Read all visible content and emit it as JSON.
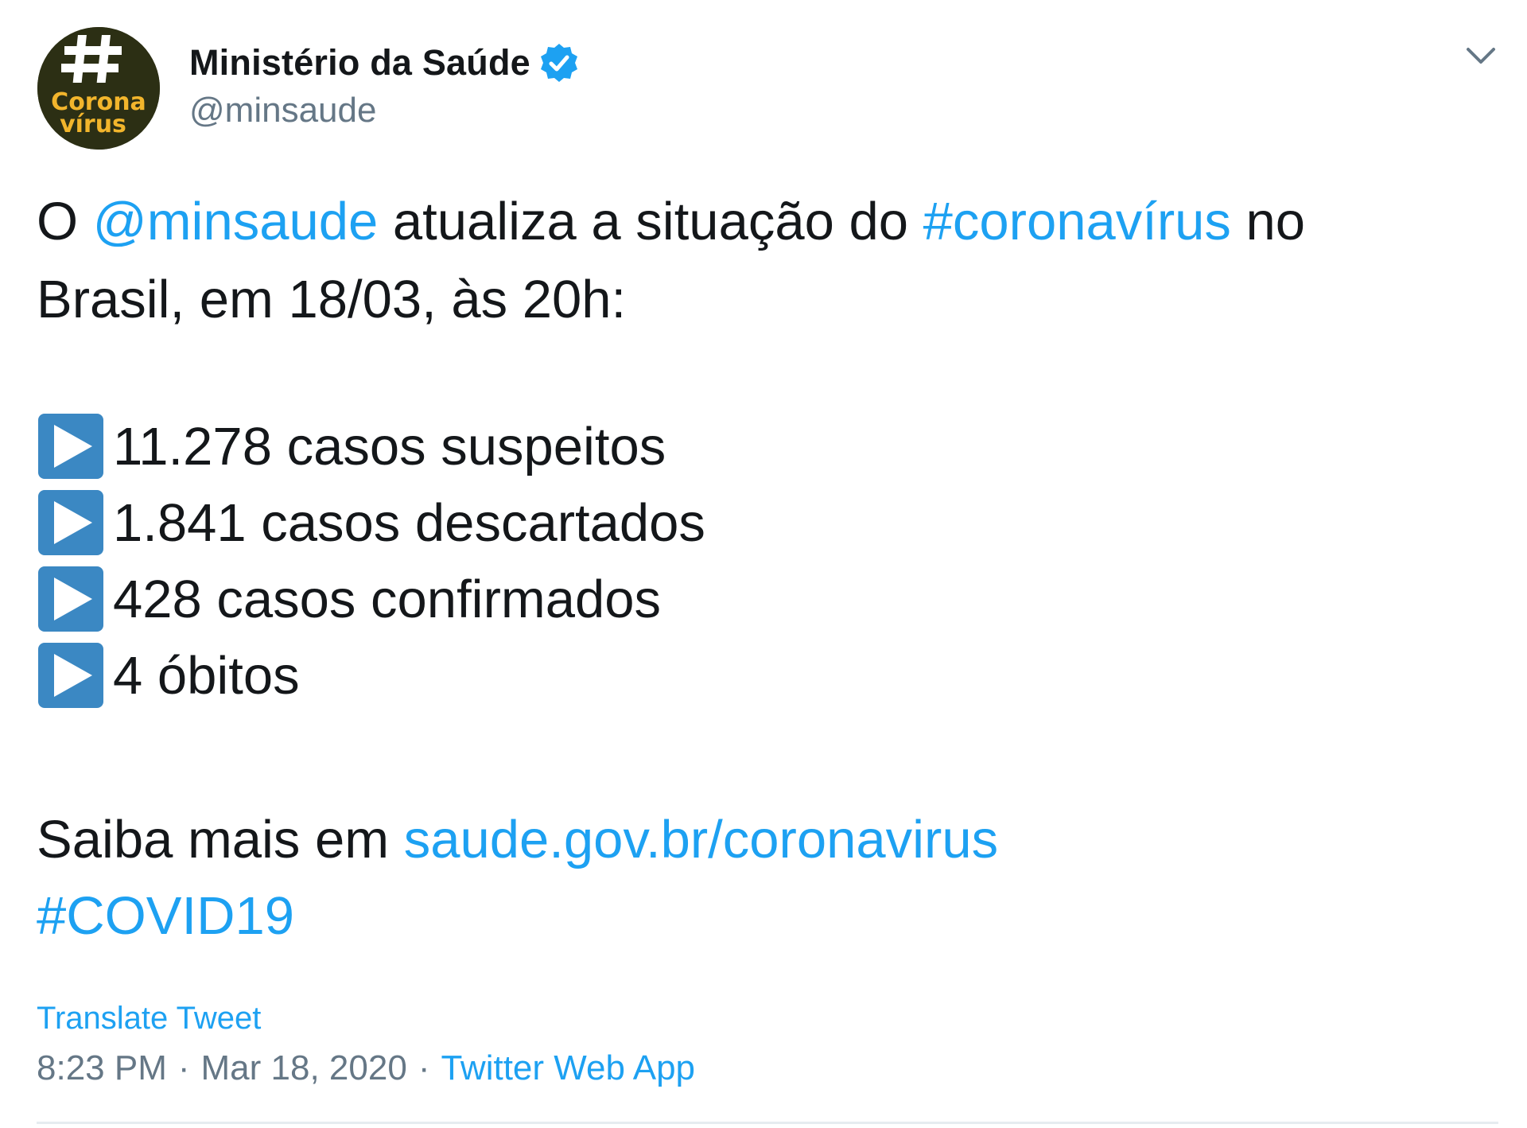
{
  "author": {
    "display_name": "Ministério da Saúde",
    "handle": "@minsaude",
    "verified": true,
    "avatar": {
      "symbol": "#",
      "line1": "Corona",
      "line2": "vírus",
      "bg_color": "#2c2f14",
      "text_color": "#f2b52c"
    }
  },
  "tweet": {
    "line1": {
      "prefix": "O ",
      "mention": "@minsaude",
      "middle": " atualiza a situação do ",
      "hashtag": "#coronavírus",
      "suffix": " no"
    },
    "line2": "Brasil,  em 18/03, às 20h:",
    "stats": [
      "11.278 casos suspeitos",
      "1.841 casos descartados",
      "428 casos confirmados",
      "4 óbitos"
    ],
    "more_prefix": "Saiba mais em ",
    "more_link": "saude.gov.br/coronavirus",
    "hashtag_bottom": "#COVID19"
  },
  "footer": {
    "translate_label": "Translate Tweet",
    "time": "8:23 PM",
    "separator": "·",
    "date": "Mar 18, 2020",
    "source": "Twitter Web App"
  },
  "icons": {
    "verified": "verified-badge-icon",
    "menu": "chevron-down-icon",
    "bullet": "play-button-icon"
  },
  "colors": {
    "link": "#1da1f2",
    "text": "#14171a",
    "secondary": "#657786",
    "bullet_blue": "#3b88c3"
  }
}
